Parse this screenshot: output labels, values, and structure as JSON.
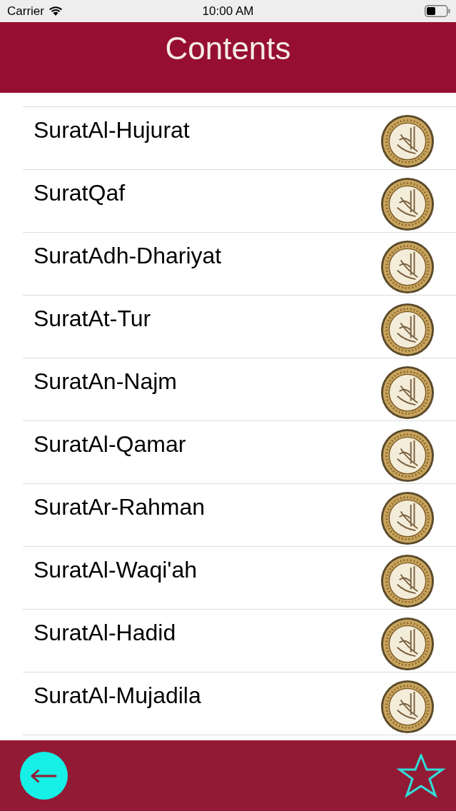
{
  "status_bar": {
    "carrier": "Carrier",
    "time": "10:00 AM"
  },
  "header": {
    "title": "Contents"
  },
  "rows": [
    {
      "name": "SuratAl-Hujurat"
    },
    {
      "name": "SuratQaf"
    },
    {
      "name": "SuratAdh-Dhariyat"
    },
    {
      "name": "SuratAt-Tur"
    },
    {
      "name": "SuratAn-Najm"
    },
    {
      "name": "SuratAl-Qamar"
    },
    {
      "name": "SuratAr-Rahman"
    },
    {
      "name": "SuratAl-Waqi'ah"
    },
    {
      "name": "SuratAl-Hadid"
    },
    {
      "name": "SuratAl-Mujadila"
    }
  ]
}
